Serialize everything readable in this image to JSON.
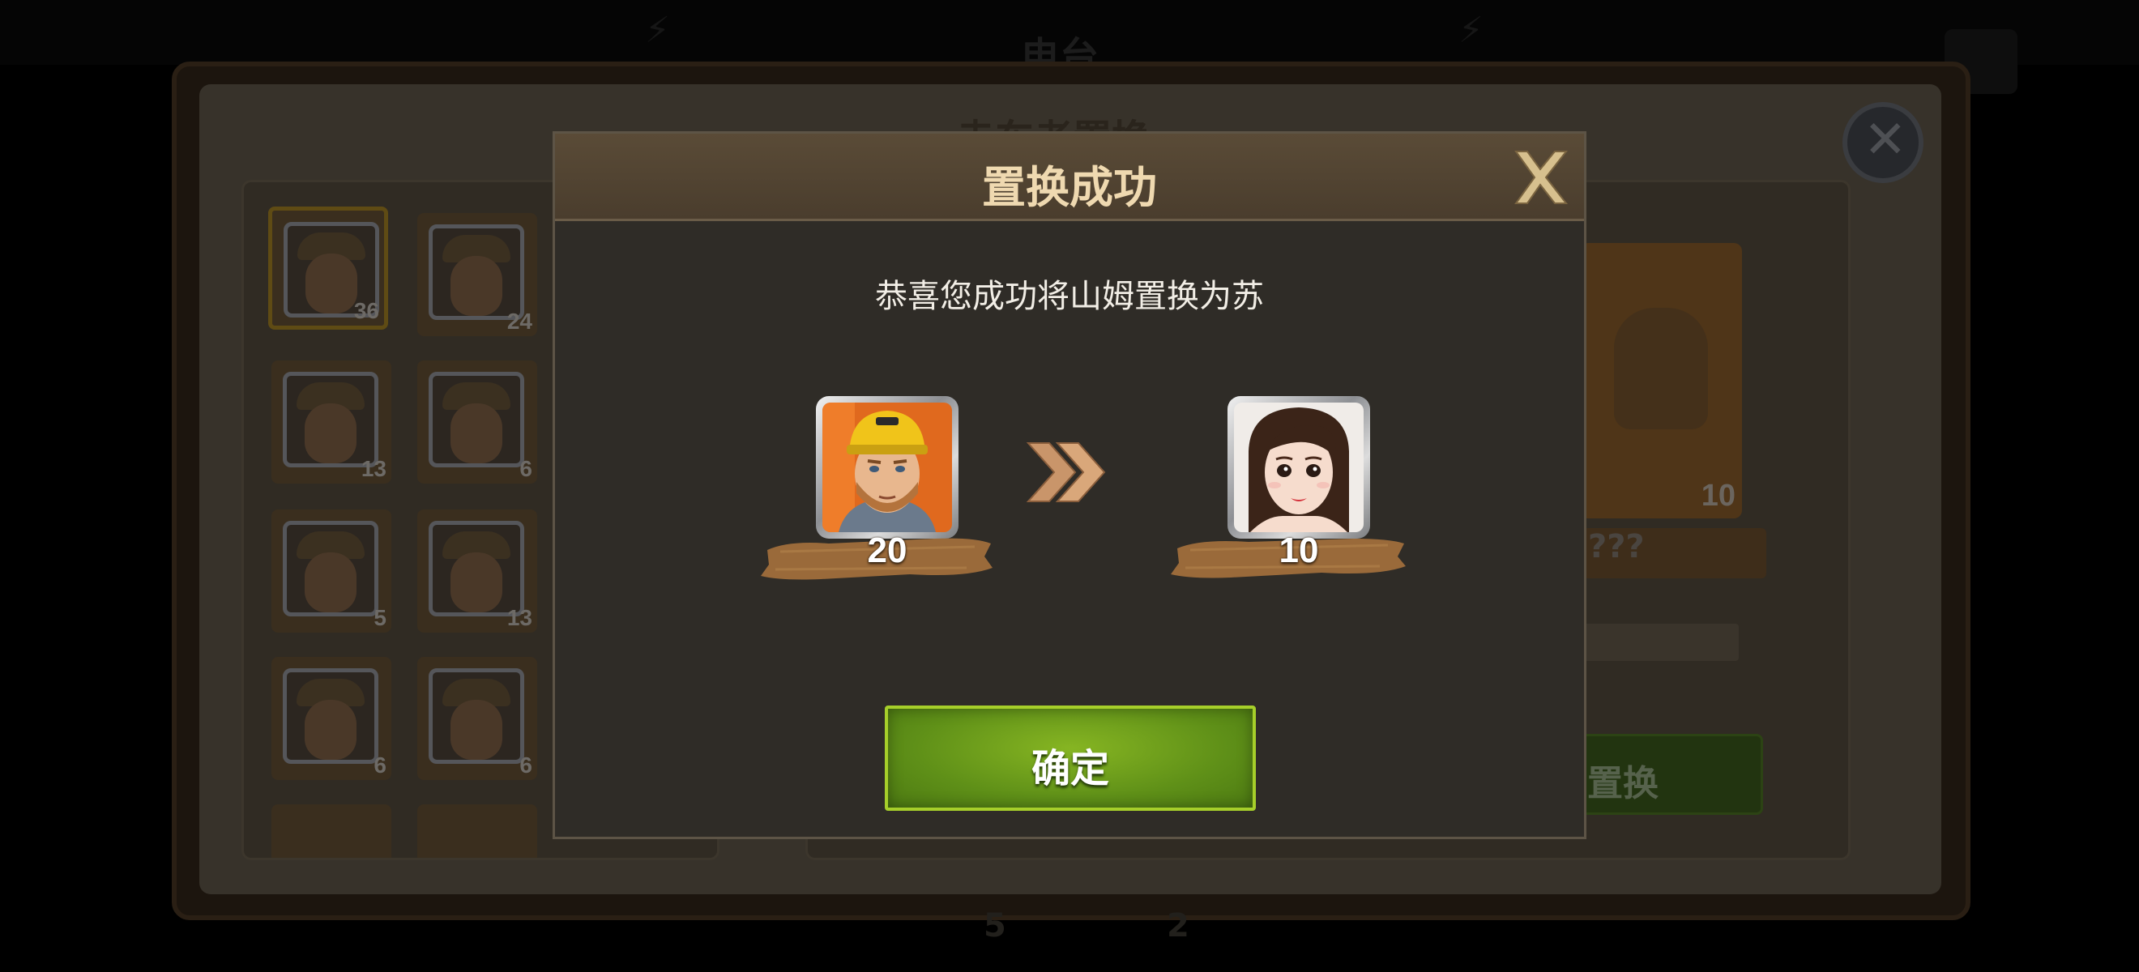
{
  "dialog": {
    "title": "置换成功",
    "message": "恭喜您成功将山姆置换为苏",
    "confirm_label": "确定",
    "close_icon": "close-x-icon",
    "arrow_icon": "double-chevron-right-icon"
  },
  "swap": {
    "from": {
      "portrait": "male-hero-yellow-helmet",
      "count": "20"
    },
    "to": {
      "portrait": "female-hero-brown-hair",
      "count": "10"
    }
  },
  "background": {
    "panel_title": "走车者置换",
    "top_title": "电台",
    "hero_counts": [
      "36",
      "24",
      "13",
      "6",
      "5",
      "13",
      "6",
      "6"
    ],
    "target_count": "10",
    "target_name": "???",
    "swap_button_label": "置换",
    "bottom_counts": [
      "5",
      "2"
    ]
  },
  "colors": {
    "header_bg": "#4f4130",
    "title_text": "#efd9b0",
    "confirm_green": "#6a9c1c",
    "confirm_border": "#a6cf2a",
    "strip_brown": "#9a6a3a"
  }
}
